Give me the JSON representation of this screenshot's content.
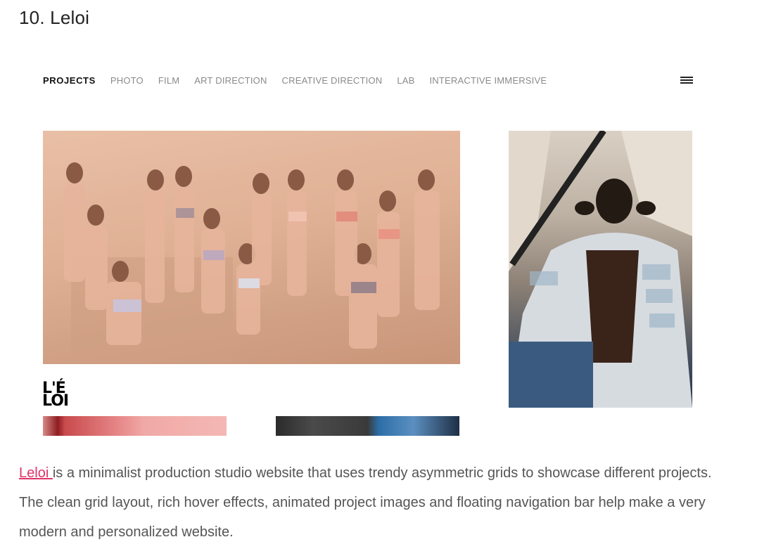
{
  "heading": "10. Leloi",
  "nav": {
    "items": [
      {
        "label": "PROJECTS",
        "active": true
      },
      {
        "label": "PHOTO",
        "active": false
      },
      {
        "label": "FILM",
        "active": false
      },
      {
        "label": "ART DIRECTION",
        "active": false
      },
      {
        "label": "CREATIVE DIRECTION",
        "active": false
      },
      {
        "label": "LAB",
        "active": false
      },
      {
        "label": "INTERACTIVE IMMERSIVE",
        "active": false
      }
    ],
    "menu_icon": "hamburger-menu-icon"
  },
  "logo": {
    "line1": "L'É",
    "line2": "LOI"
  },
  "paragraph": {
    "link_text": "Leloi ",
    "text": "is a minimalist production studio website that uses trendy asymmetric grids to showcase different projects. The clean grid layout, rich hover effects, animated project images and floating navigation bar help make a very modern and personalized website."
  },
  "colors": {
    "link": "#e0336b",
    "text": "#555555",
    "nav_active": "#111111",
    "nav_inactive": "#8a8a8a"
  }
}
